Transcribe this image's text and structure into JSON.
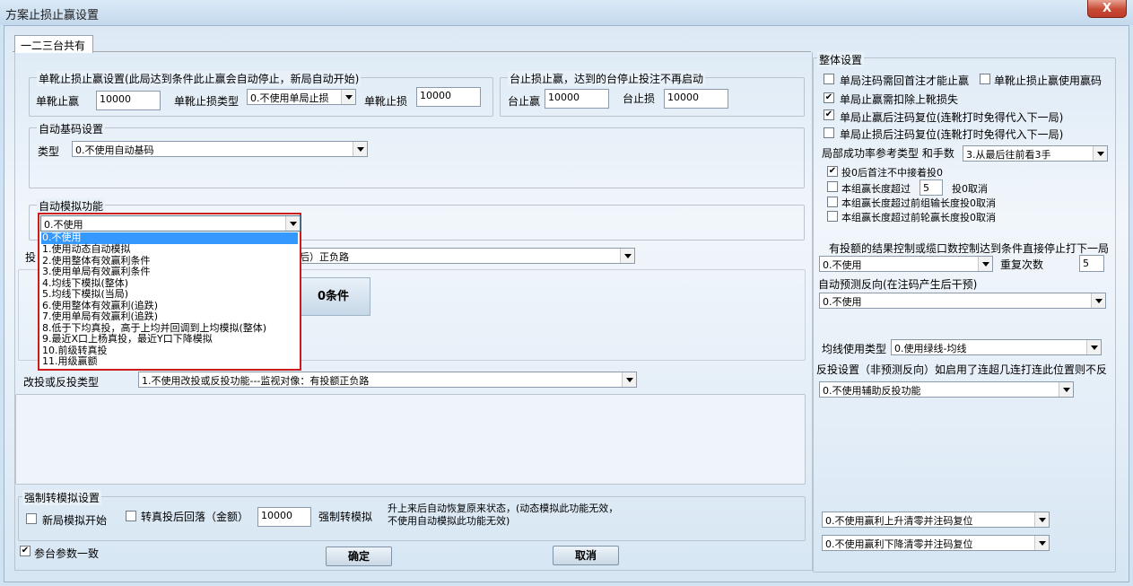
{
  "window": {
    "title": "方案止损止赢设置",
    "close": "X"
  },
  "tabs": [
    "一二三台共有"
  ],
  "single_stop": {
    "legend": "单靴止损止赢设置(此局达到条件此止赢会自动停止，新局自动开始)",
    "win_label": "单靴止赢",
    "win_value": "10000",
    "type_label": "单靴止损类型",
    "type_value": "0.不使用单局止损",
    "loss_label": "单靴止损",
    "loss_value": "10000"
  },
  "table_stop": {
    "legend": "台止损止赢，达到的台停止投注不再启动",
    "win_label": "台止赢",
    "win_value": "10000",
    "loss_label": "台止损",
    "loss_value": "10000"
  },
  "auto_base": {
    "legend": "自动基码设置",
    "type_label": "类型",
    "type_value": "0.不使用自动基码"
  },
  "auto_sim": {
    "legend": "自动模拟功能",
    "selected": "0.不使用",
    "options": [
      "0.不使用",
      "1.使用动态自动模拟",
      "2.使用整体有效赢利条件",
      "3.使用单局有效赢利条件",
      "4.均线下模拟(整体)",
      "5.均线下模拟(当局)",
      "6.使用整体有效赢利(追跌)",
      "7.使用单局有效赢利(追跌)",
      "8.低于下均真投，高于上均并回调到上均模拟(整体)",
      "9.最近X口上杨真投，最近Y口下降模拟",
      "10.前级转真投",
      "11.用级赢额"
    ]
  },
  "hidden_row": {
    "label_prefix": "投",
    "value_suffix": "后）正负路",
    "big_button": "0条件"
  },
  "change_bet": {
    "label": "改投或反投类型",
    "value": "1.不使用改投或反投功能---监视对像：有投额正负路"
  },
  "force_sim": {
    "legend": "强制转模拟设置",
    "new_round": "新局模拟开始",
    "after_drop": "转真投后回落（金额）",
    "drop_value": "10000",
    "force_label": "强制转模拟",
    "note": "升上来后自动恢复原来状态，(动态模拟此功能无效，不使用自动模拟此功能无效)"
  },
  "bottom": {
    "same_params": "参台参数一致",
    "ok": "确定",
    "cancel": "取消"
  },
  "overall": {
    "legend": "整体设置",
    "cb1": "单局注码需回首注才能止赢",
    "cb2": "单靴止损止赢使用赢码",
    "cb3": "单局止赢需扣除上靴损失",
    "cb4": "单局止赢后注码复位(连靴打时免得代入下一局)",
    "cb5": "单局止损后注码复位(连靴打时免得代入下一局)",
    "ref_label": "局部成功率参考类型 和手数",
    "ref_value": "3.从最后往前看3手",
    "cb6": "投0后首注不中接着投0",
    "cb7_a": "本组赢长度超过",
    "cb7_val": "5",
    "cb7_b": "投0取消",
    "cb8": "本组赢长度超过前组输长度投0取消",
    "cb9": "本组赢长度超过前轮赢长度投0取消",
    "ctrl_label": "有投额的结果控制或缆口数控制达到条件直接停止打下一局",
    "ctrl_value": "0.不使用",
    "repeat_label": "重复次数",
    "repeat_value": "5",
    "predict_label": "自动预测反向(在注码产生后干预)",
    "predict_value": "0.不使用",
    "ma_label": "均线使用类型",
    "ma_value": "0.使用绿线-均线",
    "reverse_label": "反投设置（非预测反向）如启用了连超几连打连此位置则不反",
    "reverse_value": "0.不使用辅助反投功能",
    "up_value": "0.不使用赢利上升清零并注码复位",
    "down_value": "0.不使用赢利下降清零并注码复位"
  }
}
